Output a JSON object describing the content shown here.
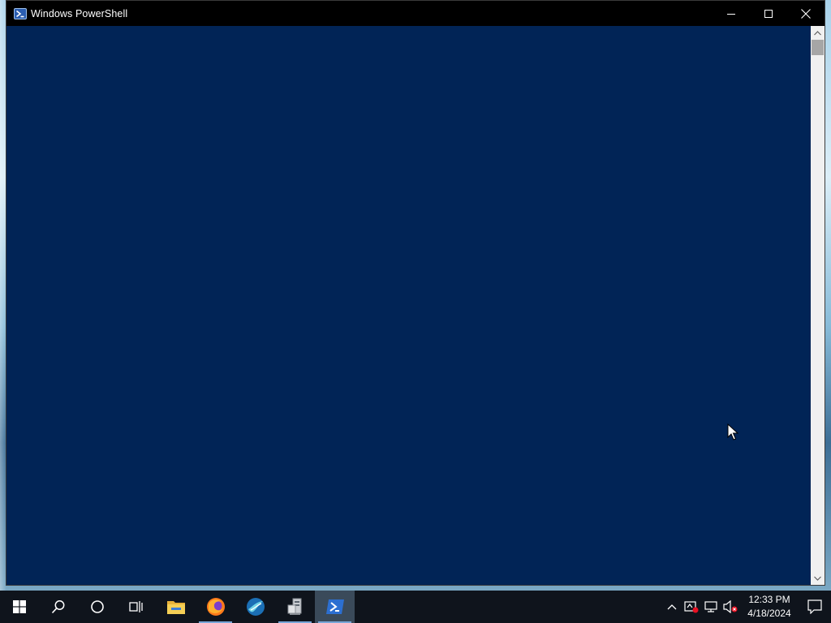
{
  "window": {
    "title": "Windows PowerShell",
    "background_color": "#012456",
    "titlebar_color": "#000000",
    "icon": "powershell-icon",
    "controls": [
      "minimize-icon",
      "maximize-icon",
      "close-icon"
    ]
  },
  "taskbar": {
    "start_icon": "windows-logo-icon",
    "search_icon": "search-icon",
    "cortana_icon": "cortana-icon",
    "task_view_icon": "task-view-icon",
    "pinned_apps": [
      {
        "name": "File Explorer",
        "icon": "folder-icon"
      },
      {
        "name": "Firefox",
        "icon": "firefox-icon"
      },
      {
        "name": "Wireshark",
        "icon": "wireshark-icon"
      },
      {
        "name": "Server Manager",
        "icon": "server-manager-icon"
      },
      {
        "name": "Windows PowerShell",
        "icon": "powershell-icon",
        "active": true
      }
    ]
  },
  "tray": {
    "icons": [
      "chevron-up-icon",
      "security-alert-icon",
      "network-icon",
      "volume-muted-icon"
    ],
    "time": "12:33 PM",
    "date": "4/18/2024",
    "notification_icon": "action-center-icon"
  }
}
